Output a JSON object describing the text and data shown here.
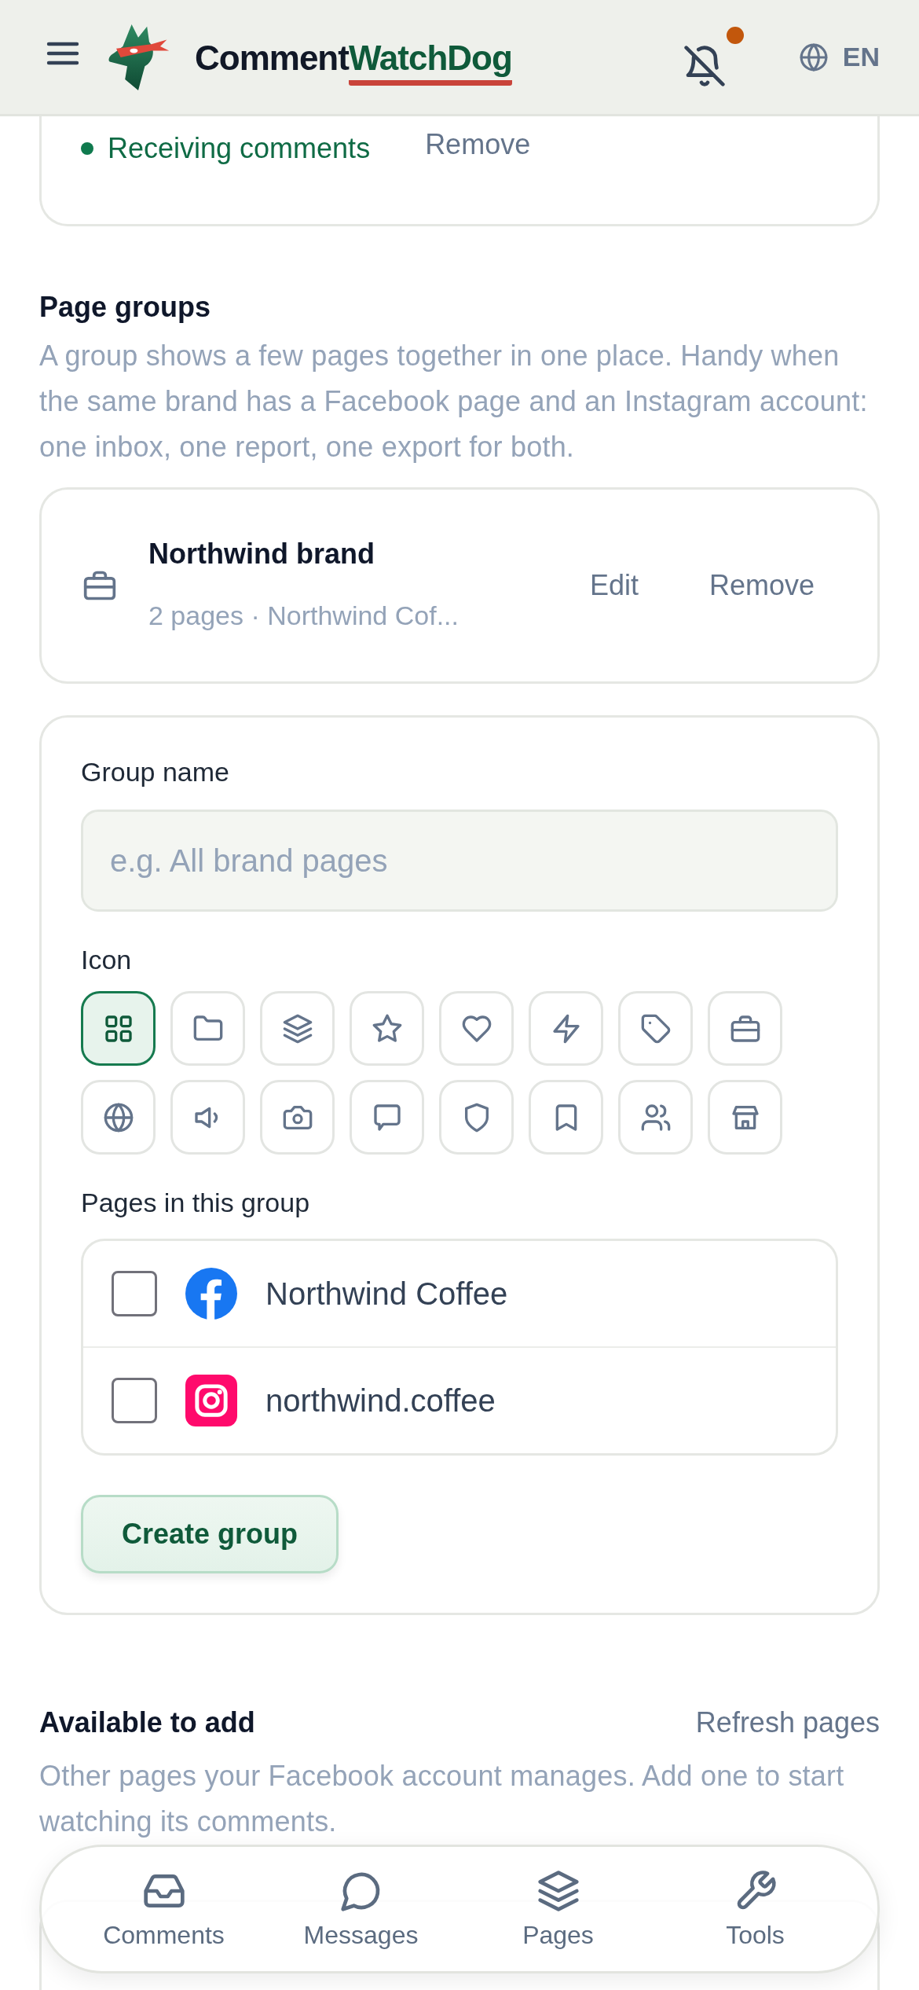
{
  "header": {
    "brand_parts": [
      {
        "text": "Comment",
        "kind": "plain"
      },
      {
        "text": "WatchDog",
        "kind": "accent"
      }
    ],
    "bell_muted": true,
    "has_unread": true,
    "language": "EN"
  },
  "connected_page": {
    "status": "Receiving comments",
    "action": "Remove"
  },
  "page_groups": {
    "title": "Page groups",
    "description": "A group shows a few pages together in one place. Handy when the same brand has a Facebook page and an Instagram account: one inbox, one report, one export for both.",
    "groups": [
      {
        "name": "Northwind brand",
        "summary": "2 pages · Northwind Cof...",
        "actions": [
          "Edit",
          "Remove"
        ]
      }
    ]
  },
  "new_group_form": {
    "name_label": "Group name",
    "name_placeholder": "e.g. All brand pages",
    "icon_label": "Icon",
    "icons": [
      {
        "kind": "grid",
        "selected": true
      },
      {
        "kind": "folder",
        "selected": false
      },
      {
        "kind": "layers",
        "selected": false
      },
      {
        "kind": "star",
        "selected": false
      },
      {
        "kind": "heart",
        "selected": false
      },
      {
        "kind": "bolt",
        "selected": false
      },
      {
        "kind": "tag",
        "selected": false
      },
      {
        "kind": "briefcase",
        "selected": false
      },
      {
        "kind": "globe",
        "selected": false
      },
      {
        "kind": "speaker",
        "selected": false
      },
      {
        "kind": "camera",
        "selected": false
      },
      {
        "kind": "chat",
        "selected": false
      },
      {
        "kind": "shield",
        "selected": false
      },
      {
        "kind": "bookmark",
        "selected": false
      },
      {
        "kind": "users",
        "selected": false
      },
      {
        "kind": "store",
        "selected": false
      }
    ],
    "pages_label": "Pages in this group",
    "pages": [
      {
        "kind": "facebook",
        "name": "Northwind Coffee",
        "checked": false
      },
      {
        "kind": "instagram",
        "name": "northwind.coffee",
        "checked": false
      }
    ],
    "submit": "Create group"
  },
  "available": {
    "title": "Available to add",
    "refresh": "Refresh pages",
    "description": "Other pages your Facebook account manages. Add one to start watching its comments."
  },
  "bottom_nav": [
    {
      "kind": "inbox",
      "label": "Comments"
    },
    {
      "kind": "chat-round",
      "label": "Messages"
    },
    {
      "kind": "layers",
      "label": "Pages"
    },
    {
      "kind": "wrench",
      "label": "Tools"
    }
  ]
}
